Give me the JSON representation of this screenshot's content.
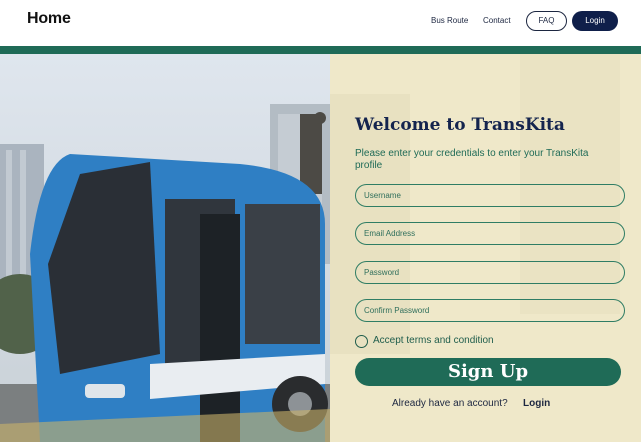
{
  "header": {
    "brand": "Home",
    "nav": {
      "bus_route": "Bus Route",
      "contact": "Contact"
    },
    "faq_label": "FAQ",
    "login_label": "Login"
  },
  "form": {
    "title": "Welcome to TransKita",
    "subtitle": "Please enter your credentials to enter your TransKita profile",
    "username_placeholder": "Username",
    "email_placeholder": "Email Address",
    "password_placeholder": "Password",
    "confirm_password_placeholder": "Confirm Password",
    "terms_label": "Accept terms and condition",
    "signup_label": "Sign Up",
    "already_text": "Already have an account?",
    "login_link": "Login"
  },
  "colors": {
    "brand_navy": "#0f1f4a",
    "accent_green": "#1f6b57",
    "form_background": "#efe8c9"
  }
}
